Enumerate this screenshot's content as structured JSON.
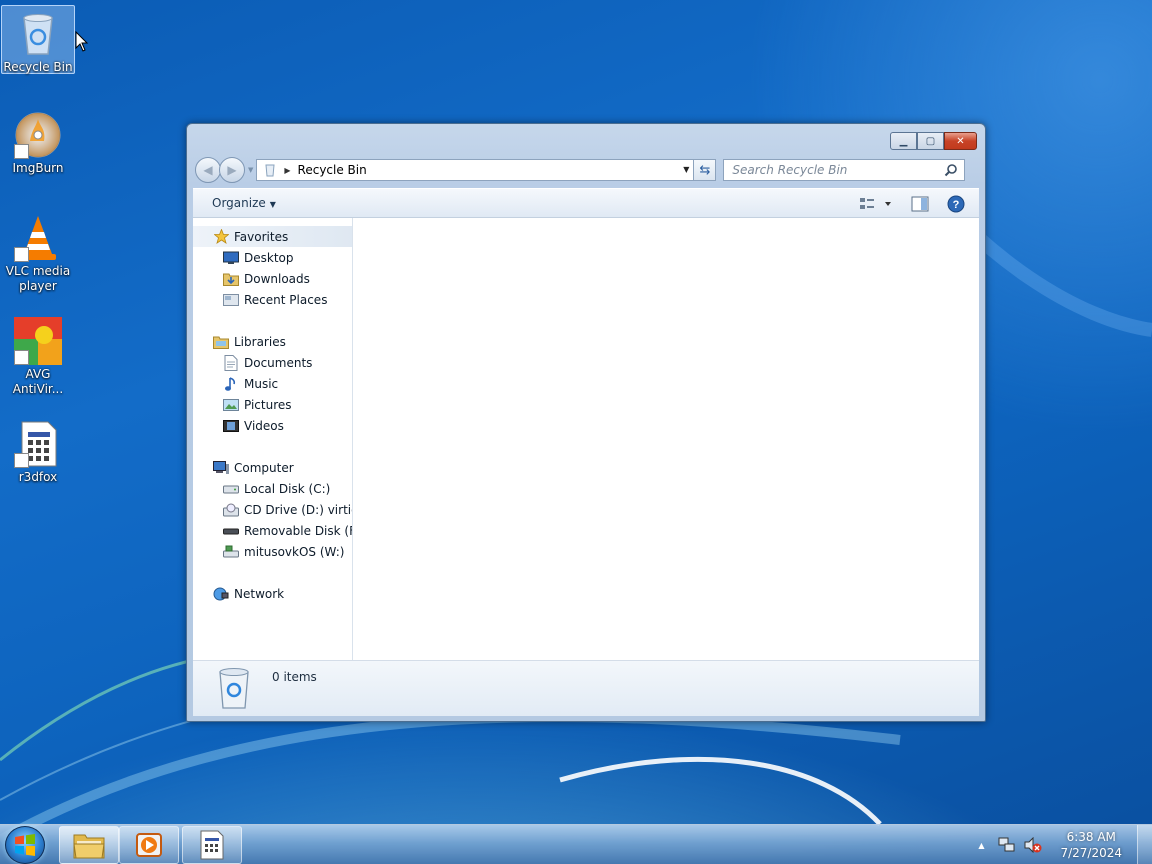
{
  "desktop": {
    "icons": [
      {
        "label": "Recycle Bin",
        "icon": "recycle-bin-icon"
      },
      {
        "label": "ImgBurn",
        "icon": "imgburn-icon"
      },
      {
        "label": "VLC media player",
        "icon": "vlc-icon"
      },
      {
        "label": "AVG AntiVir...",
        "icon": "avg-icon"
      },
      {
        "label": "r3dfox",
        "icon": "r3dfox-icon"
      }
    ]
  },
  "window": {
    "title": "Recycle Bin",
    "address": {
      "path": "Recycle Bin"
    },
    "search": {
      "placeholder": "Search Recycle Bin"
    },
    "toolbar": {
      "organize": "Organize"
    },
    "nav": {
      "favorites": {
        "label": "Favorites",
        "items": [
          "Desktop",
          "Downloads",
          "Recent Places"
        ]
      },
      "libraries": {
        "label": "Libraries",
        "items": [
          "Documents",
          "Music",
          "Pictures",
          "Videos"
        ]
      },
      "computer": {
        "label": "Computer",
        "items": [
          "Local Disk (C:)",
          "CD Drive (D:) virtio-win",
          "Removable Disk (F:)",
          "mitusovkOS (W:)"
        ]
      },
      "network": {
        "label": "Network"
      }
    },
    "details": {
      "count": "0 items"
    }
  },
  "taskbar": {
    "apps": [
      "Windows Explorer",
      "Windows Media Player",
      "r3dfox"
    ],
    "clock": {
      "time": "6:38 AM",
      "date": "7/27/2024"
    }
  },
  "colors": {
    "accent": "#1467c4",
    "close": "#c84327"
  }
}
